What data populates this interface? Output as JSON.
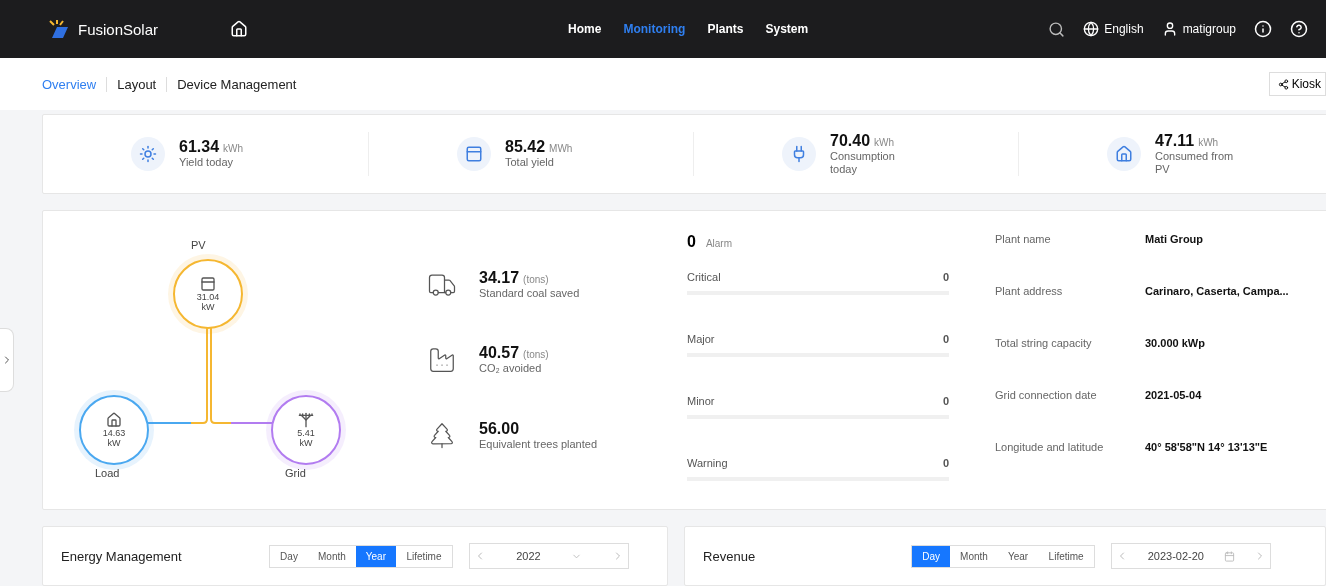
{
  "topbar": {
    "logo": "FusionSolar",
    "menu": [
      {
        "label": "Home",
        "selected": false
      },
      {
        "label": "Monitoring",
        "selected": true
      },
      {
        "label": "Plants",
        "selected": false
      },
      {
        "label": "System",
        "selected": false
      }
    ],
    "language": "English",
    "user": "matigroup"
  },
  "subnav": {
    "tabs": [
      {
        "label": "Overview",
        "selected": true
      },
      {
        "label": "Layout",
        "selected": false
      },
      {
        "label": "Device Management",
        "selected": false
      }
    ],
    "kiosk": "Kiosk"
  },
  "kpis": [
    {
      "kind": "sun",
      "value": "61.34",
      "unit": "kWh",
      "label": "Yield today"
    },
    {
      "kind": "panel",
      "value": "85.42",
      "unit": "MWh",
      "label": "Total yield"
    },
    {
      "kind": "plug",
      "value": "70.40",
      "unit": "kWh",
      "label": "Consumption today"
    },
    {
      "kind": "house",
      "value": "47.11",
      "unit": "kWh",
      "label": "Consumed from PV"
    }
  ],
  "flow": {
    "nodes": [
      {
        "kind": "pv",
        "label": "PV",
        "value": "31.04",
        "unit": "kW",
        "color": "#f5b731"
      },
      {
        "kind": "load",
        "label": "Load",
        "value": "14.63",
        "unit": "kW",
        "color": "#4aa8f0"
      },
      {
        "kind": "grid",
        "label": "Grid",
        "value": "5.41",
        "unit": "kW",
        "color": "#b27cf0"
      }
    ]
  },
  "environment": [
    {
      "kind": "coal",
      "value": "34.17",
      "unit": "(tons)",
      "label": "Standard coal saved"
    },
    {
      "kind": "co2",
      "value": "40.57",
      "unit": "(tons)",
      "label": "CO₂ avoided"
    },
    {
      "kind": "tree",
      "value": "56.00",
      "label": "Equivalent trees planted"
    }
  ],
  "alarms": {
    "total": "0",
    "label": "Alarm",
    "levels": [
      {
        "label": "Critical",
        "count": "0"
      },
      {
        "label": "Major",
        "count": "0"
      },
      {
        "label": "Minor",
        "count": "0"
      },
      {
        "label": "Warning",
        "count": "0"
      }
    ]
  },
  "plant_info": [
    {
      "label": "Plant name",
      "value": "Mati Group"
    },
    {
      "label": "Plant address",
      "value": "Carinaro, Caserta, Campa..."
    },
    {
      "label": "Total string capacity",
      "value": "30.000 kWp"
    },
    {
      "label": "Grid connection date",
      "value": "2021-05-04"
    },
    {
      "label": "Longitude and latitude",
      "value": "40° 58'58\"N   14° 13'13\"E"
    }
  ],
  "panels": [
    {
      "title": "Energy Management",
      "periods": [
        {
          "label": "Day",
          "selected": false
        },
        {
          "label": "Month",
          "selected": false
        },
        {
          "label": "Year",
          "selected": true
        },
        {
          "label": "Lifetime",
          "selected": false
        }
      ],
      "date": "2022",
      "kind": "year"
    },
    {
      "title": "Revenue",
      "periods": [
        {
          "label": "Day",
          "selected": true
        },
        {
          "label": "Month",
          "selected": false
        },
        {
          "label": "Year",
          "selected": false
        },
        {
          "label": "Lifetime",
          "selected": false
        }
      ],
      "date": "2023-02-20",
      "kind": "day"
    }
  ]
}
